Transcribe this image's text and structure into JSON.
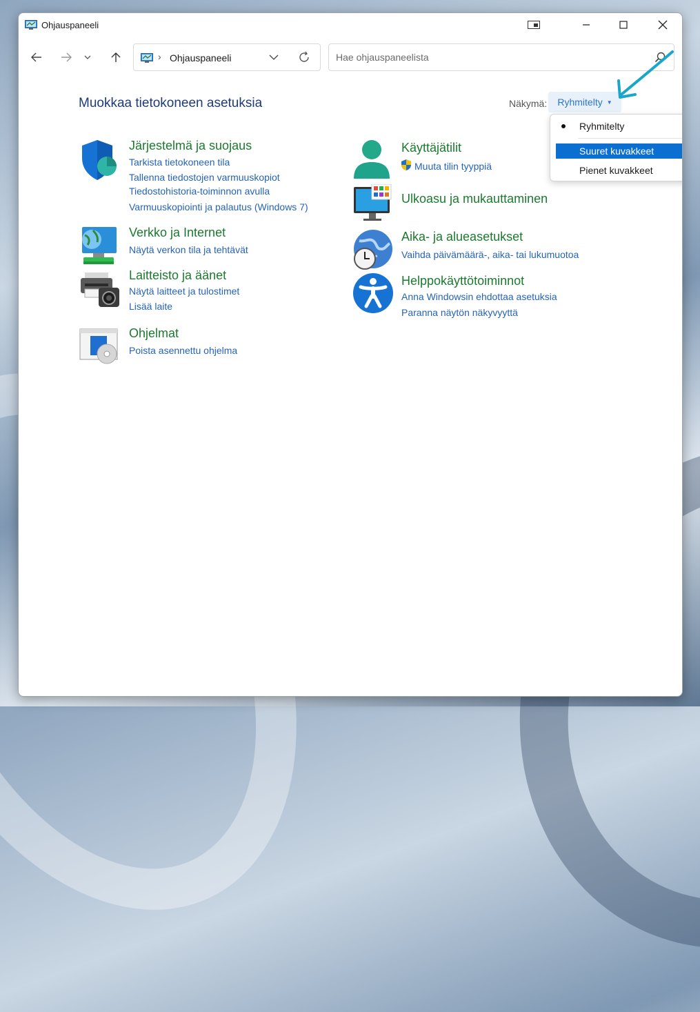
{
  "window": {
    "title": "Ohjauspaneeli"
  },
  "nav": {
    "breadcrumb": "Ohjauspaneeli",
    "search_placeholder": "Hae ohjauspaneelista"
  },
  "main": {
    "heading": "Muokkaa tietokoneen asetuksia",
    "view_label": "Näkymä:",
    "view_value": "Ryhmitelty"
  },
  "view_menu": {
    "items": [
      {
        "label": "Ryhmitelty",
        "checked": true
      },
      {
        "label": "Suuret kuvakkeet",
        "highlighted": true
      },
      {
        "label": "Pienet kuvakkeet"
      }
    ]
  },
  "categories": {
    "system": {
      "title": "Järjestelmä ja suojaus",
      "links": [
        "Tarkista tietokoneen tila",
        "Tallenna tiedostojen varmuuskopiot",
        "Tiedostohistoria-toiminnon avulla",
        "Varmuuskopiointi ja palautus (Windows 7)"
      ]
    },
    "network": {
      "title": "Verkko ja Internet",
      "links": [
        "Näytä verkon tila ja tehtävät"
      ]
    },
    "hardware": {
      "title": "Laitteisto ja äänet",
      "links": [
        "Näytä laitteet ja tulostimet",
        "Lisää laite"
      ]
    },
    "programs": {
      "title": "Ohjelmat",
      "links": [
        "Poista asennettu ohjelma"
      ]
    },
    "users": {
      "title": "Käyttäjätilit",
      "links": [
        "Muuta tilin tyyppiä"
      ]
    },
    "appearance": {
      "title": "Ulkoasu ja mukauttaminen",
      "links": []
    },
    "clock": {
      "title": "Aika- ja alueasetukset",
      "links": [
        "Vaihda päivämäärä-, aika- tai lukumuotoa"
      ]
    },
    "access": {
      "title": "Helppokäyttötoiminnot",
      "links": [
        "Anna Windowsin ehdottaa asetuksia",
        "Paranna näytön näkyvyyttä"
      ]
    }
  },
  "colors": {
    "category_title": "#1b7a2d",
    "link": "#2563b8",
    "heading": "#1e3a7a",
    "menu_highlight": "#0b6fd1",
    "annotation_arrow": "#1aa6c8"
  }
}
